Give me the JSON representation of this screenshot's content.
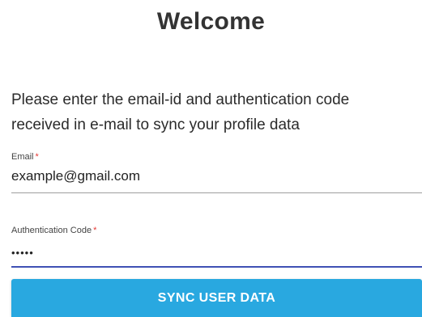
{
  "header": {
    "title": "Welcome"
  },
  "main": {
    "instructions_line1": "Please enter the email-id and authentication code",
    "instructions_line2": "received in e-mail to sync your profile data",
    "email": {
      "label": "Email",
      "required_marker": "*",
      "value": "example@gmail.com"
    },
    "auth_code": {
      "label": "Authentication Code",
      "required_marker": "*",
      "value": "•••••"
    },
    "sync_button_label": "SYNC USER DATA"
  },
  "colors": {
    "accent": "#3f51b5",
    "button": "#29a8e0",
    "required": "#e53935"
  }
}
